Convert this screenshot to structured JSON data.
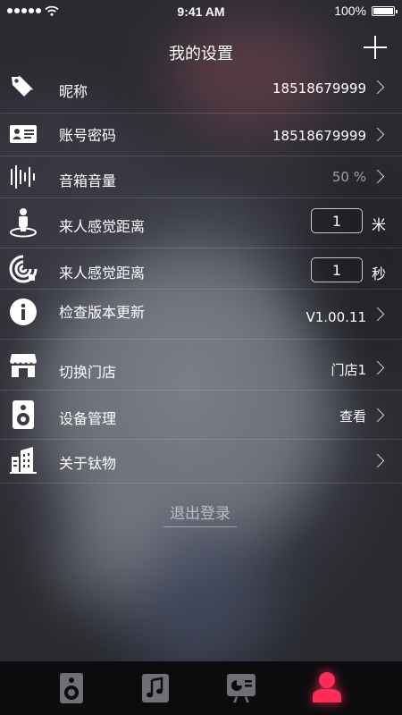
{
  "status_bar": {
    "time": "9:41 AM",
    "battery": "100%",
    "signal_icon": "signal-dots-icon",
    "wifi_icon": "wifi-icon"
  },
  "header": {
    "title": "我的设置",
    "add_icon": "plus-icon"
  },
  "settings": {
    "nickname": {
      "label": "昵称",
      "value": "18518679999",
      "icon": "tag-icon"
    },
    "account": {
      "label": "账号密码",
      "value": "18518679999",
      "icon": "id-card-icon"
    },
    "volume": {
      "label": "音箱音量",
      "value": "50 %",
      "icon": "sound-wave-icon"
    },
    "sense_distance_1": {
      "label": "来人感觉距离",
      "value": "1",
      "unit": "米",
      "icon": "person-sensor-icon"
    },
    "sense_distance_2": {
      "label": "来人感觉距离",
      "value": "1",
      "unit": "秒",
      "icon": "signal-radar-icon"
    },
    "version": {
      "label": "检查版本更新",
      "value": "V1.00.11",
      "icon": "info-icon"
    },
    "store": {
      "label": "切换门店",
      "value": "门店1",
      "icon": "store-icon"
    },
    "devices": {
      "label": "设备管理",
      "value": "查看",
      "icon": "speaker-icon"
    },
    "about": {
      "label": "关于钛物",
      "icon": "building-icon"
    }
  },
  "logout_label": "退出登录",
  "tabbar": {
    "active_index": 3,
    "active_color": "#ff2d55",
    "inactive_color": "#6f6f74",
    "tabs": [
      {
        "icon": "speaker-icon"
      },
      {
        "icon": "music-note-icon"
      },
      {
        "icon": "chart-board-icon"
      },
      {
        "icon": "user-icon"
      }
    ]
  }
}
